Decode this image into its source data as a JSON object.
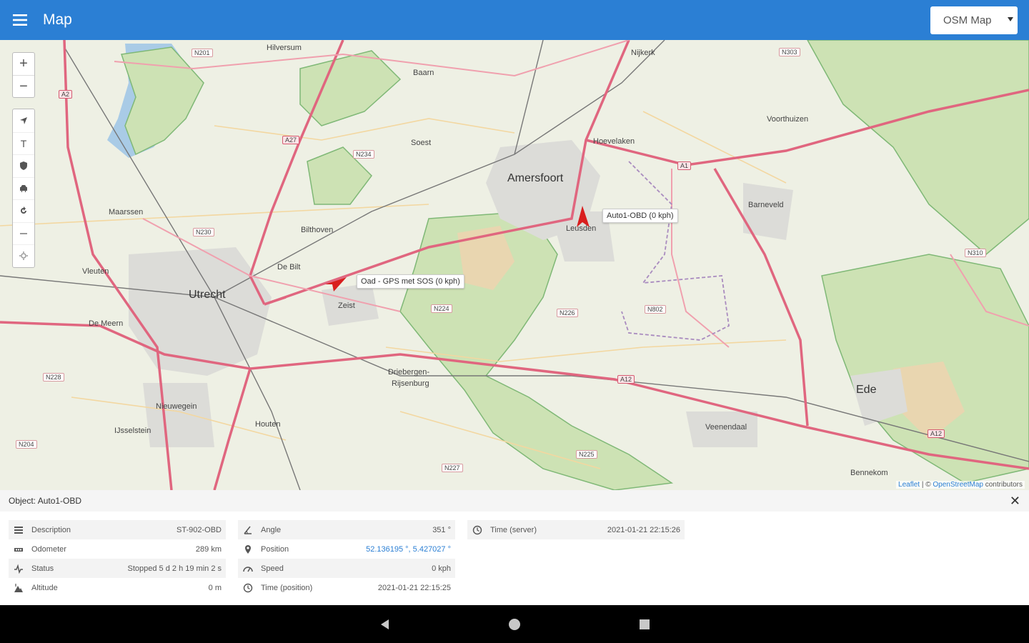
{
  "appbar": {
    "title": "Map",
    "layer_select": "OSM Map"
  },
  "map": {
    "places": {
      "hilversum": "Hilversum",
      "baarn": "Baarn",
      "nijkerk": "Nijkerk",
      "soest": "Soest",
      "hoevelaken": "Hoevelaken",
      "amersfoort": "Amersfoort",
      "voorthuizen": "Voorthuizen",
      "barneveld": "Barneveld",
      "maarssen": "Maarssen",
      "bilthoven": "Bilthoven",
      "debilt": "De Bilt",
      "leusden": "Leusden",
      "vleuten": "Vleuten",
      "utrecht": "Utrecht",
      "zeist": "Zeist",
      "demeern": "De Meern",
      "driebergen": "Driebergen-",
      "rijsenburg": "Rijsenburg",
      "ede": "Ede",
      "nieuwegein": "Nieuwegein",
      "houten": "Houten",
      "ijsselstein": "IJsselstein",
      "veenendaal": "Veenendaal",
      "rhenen": "Bennekom"
    },
    "roads": {
      "n201": "N201",
      "a2": "A2",
      "a27": "A27",
      "n234": "N234",
      "n303": "N303",
      "a1": "A1",
      "n230": "N230",
      "n310": "N310",
      "n224": "N224",
      "n226": "N226",
      "n802": "N802",
      "n228": "N228",
      "a12": "A12",
      "a12b": "A12",
      "n204": "N204",
      "n225": "N225",
      "n227": "N227"
    },
    "markers": [
      {
        "label": "Auto1-OBD (0 kph)"
      },
      {
        "label": "Oad - GPS met SOS (0 kph)"
      }
    ],
    "attribution": {
      "leaflet": "Leaflet",
      "sep": " | © ",
      "osm": "OpenStreetMap",
      "tail": " contributors"
    }
  },
  "panel": {
    "title": "Object: Auto1-OBD",
    "col1": [
      {
        "label": "Description",
        "value": "ST-902-OBD",
        "icon": "list-icon"
      },
      {
        "label": "Odometer",
        "value": "289 km",
        "icon": "odometer-icon"
      },
      {
        "label": "Status",
        "value": "Stopped 5 d 2 h 19 min 2 s",
        "icon": "status-icon"
      },
      {
        "label": "Altitude",
        "value": "0 m",
        "icon": "altitude-icon"
      }
    ],
    "col2": [
      {
        "label": "Angle",
        "value": "351 °",
        "icon": "angle-icon"
      },
      {
        "label": "Position",
        "value": "52.136195 °, 5.427027 °",
        "icon": "pin-icon"
      },
      {
        "label": "Speed",
        "value": "0 kph",
        "icon": "speed-icon"
      },
      {
        "label": "Time (position)",
        "value": "2021-01-21 22:15:25",
        "icon": "clock-icon"
      }
    ],
    "col3": [
      {
        "label": "Time (server)",
        "value": "2021-01-21 22:15:26",
        "icon": "clock-icon"
      }
    ]
  }
}
